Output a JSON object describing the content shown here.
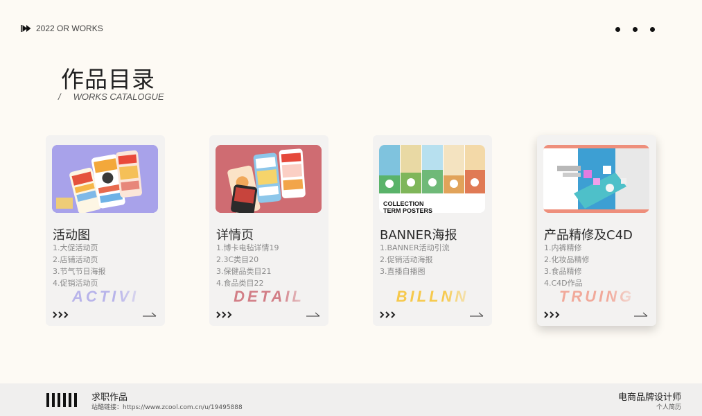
{
  "header": {
    "brand_text": "2022 OR WORKS"
  },
  "title": {
    "main": "作品目录",
    "slash": "/",
    "sub": "WORKS CATALOGUE"
  },
  "cards": [
    {
      "title": "活动图",
      "items": [
        "1.大促活动页",
        "2.店铺活动页",
        "3.节气节日海报",
        "4.促销活动页"
      ],
      "watermark": "ACTIVI",
      "watermark_color": "#b8b4ea",
      "thumb_color": "#a9a3ea"
    },
    {
      "title": "详情页",
      "items": [
        "1.博卡电毡详情19",
        "2.3C类目20",
        "3.保健品类目21",
        "4.食品类目22"
      ],
      "watermark": "DETAIL",
      "watermark_color": "#d27e86",
      "thumb_color": "#d06b72"
    },
    {
      "title": "BANNER海报",
      "items": [
        "1.BANNER活动引流",
        "2.促销活动海报",
        "3.直播自播图"
      ],
      "watermark": "BILLNN",
      "watermark_color": "#f6c94c",
      "thumb_caption_1": "COLLECTION",
      "thumb_caption_2": "TERM POSTERS"
    },
    {
      "title": "产品精修及C4D",
      "items": [
        "1.内裤精修",
        "2.化妆品精修",
        "3.食品精修",
        "4.C4D作品"
      ],
      "watermark": "TRUING",
      "watermark_color": "#f1a99a",
      "thumb_color": "#ee8f7c"
    }
  ],
  "footer": {
    "job_title": "求职作品",
    "site_link": "站酷链接：https://www.zcool.com.cn/u/19495888",
    "role": "电商品牌设计师",
    "resume": "个人简历"
  }
}
